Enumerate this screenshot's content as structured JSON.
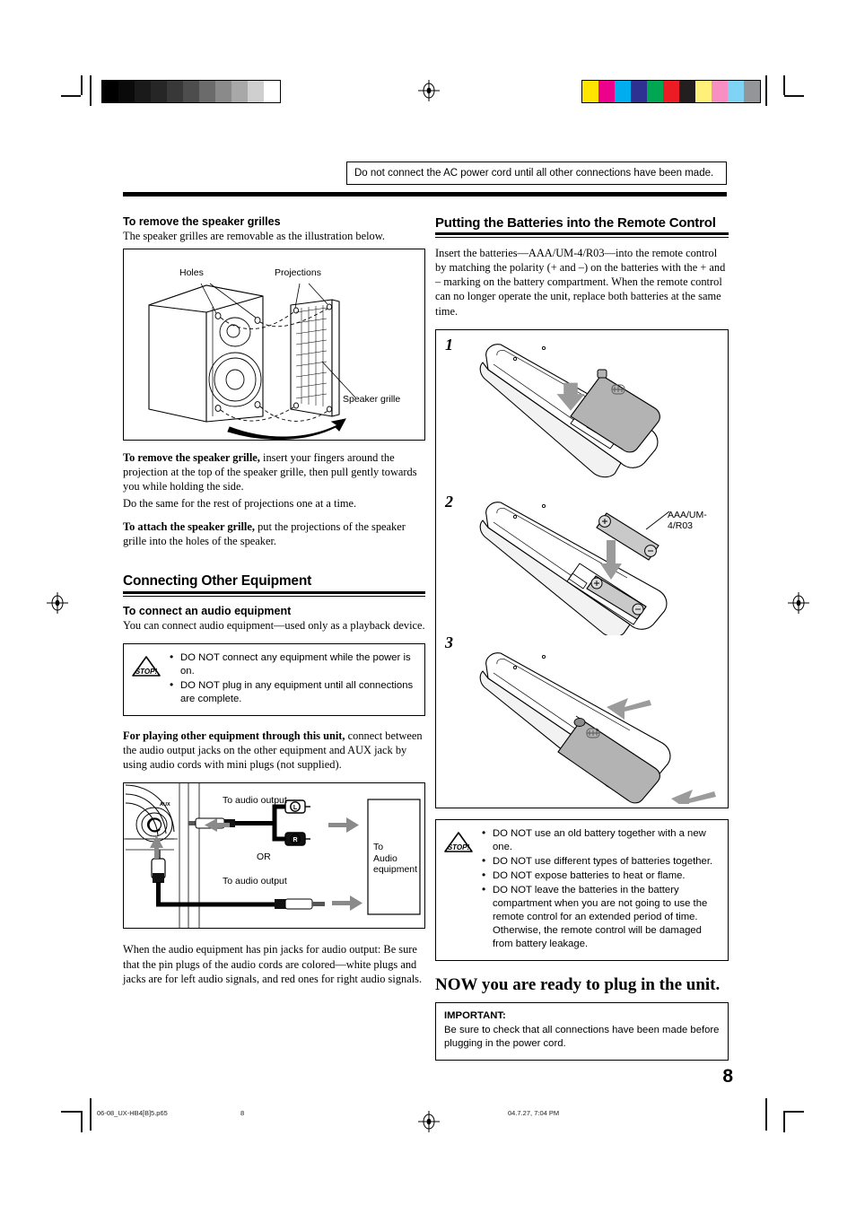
{
  "page": {
    "number": "8",
    "top_note": "Do not connect the AC power cord until all other connections have been made."
  },
  "footer": {
    "filename": "06-08_UX-HB4[B]5.p65",
    "page_label": "8",
    "timestamp": "04.7.27, 7:04 PM"
  },
  "printer_marks": {
    "gray_wedge": [
      "#000000",
      "#0a0a0a",
      "#1a1a1a",
      "#262626",
      "#383838",
      "#4d4d4d",
      "#6b6b6b",
      "#8a8a8a",
      "#a8a8a8",
      "#cfcfcf",
      "#ffffff"
    ],
    "color_bar": [
      "#FFE400",
      "#EC008C",
      "#00AEEF",
      "#2E3192",
      "#00A651",
      "#ED1C24",
      "#231F20",
      "#FFF07A",
      "#F88FC2",
      "#7FD4F5",
      "#939598"
    ]
  },
  "left_column": {
    "grilles_heading": "To remove the speaker grilles",
    "grilles_intro": "The speaker grilles are removable as the illustration below.",
    "speaker_figure": {
      "label_holes": "Holes",
      "label_projections": "Projections",
      "label_speaker_grille": "Speaker grille"
    },
    "remove_lead": "To remove the speaker grille,",
    "remove_body": " insert your fingers around the projection at the top of the speaker grille, then pull gently towards you while holding the side.",
    "remove_extra": "Do the same for the rest of projections one at a time.",
    "attach_lead": "To attach the speaker grille,",
    "attach_body": " put the projections of the speaker grille into the holes of the speaker.",
    "connecting_heading": "Connecting Other Equipment",
    "connect_audio_heading": "To connect an audio equipment",
    "connect_audio_body": "You can connect audio equipment—used only as a playback device.",
    "caution_items": [
      "DO NOT connect any equipment while the power is on.",
      "DO NOT plug in any equipment until all connections are complete."
    ],
    "playing_lead": "For playing other equipment through this unit,",
    "playing_body": " connect between the audio output jacks on the other equipment and AUX jack by using audio cords with mini plugs (not supplied).",
    "aux_figure": {
      "jack_label": "AUX",
      "to_audio_output_top": "To audio output",
      "to_audio_output_bottom": "To audio output",
      "or_label": "OR",
      "equipment_label_line1": "To",
      "equipment_label_line2": "Audio equipment",
      "plug_left": "L",
      "plug_right": "R"
    },
    "pinjack_note": "When the audio equipment has pin jacks for audio output: Be sure that the pin plugs of the audio cords are colored—white plugs and jacks are for left audio signals, and red ones for right audio signals."
  },
  "right_column": {
    "batteries_heading": "Putting the Batteries into the Remote Control",
    "batteries_intro": "Insert the batteries—AAA/UM-4/R03—into the remote control by matching the polarity (+ and –) on the batteries with the + and – marking on the battery compartment. When the remote control can no longer operate the unit, replace both batteries at the same time.",
    "steps": [
      {
        "number": "1",
        "label": ""
      },
      {
        "number": "2",
        "label": "AAA/UM-4/R03"
      },
      {
        "number": "3",
        "label": ""
      }
    ],
    "battery_caution_items": [
      "DO NOT use an old battery together with a new one.",
      "DO NOT use different types of batteries together.",
      "DO NOT expose batteries to heat or flame.",
      "DO NOT leave the batteries in the battery compartment when you are not going to use the remote control for an extended period of time. Otherwise, the remote control will be damaged from battery leakage."
    ],
    "now_ready": "NOW you are ready to plug in the unit.",
    "important_title": "IMPORTANT:",
    "important_body": "Be sure to check that all connections have been made before plugging in the power cord."
  },
  "icons": {
    "stop": "STOP!"
  }
}
